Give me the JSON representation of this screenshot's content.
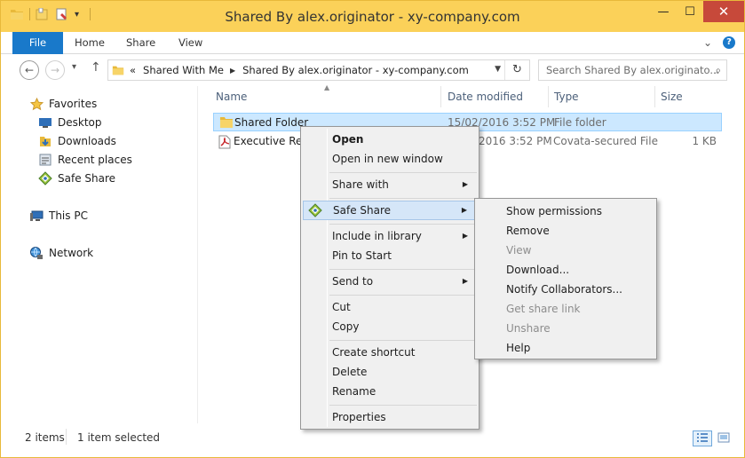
{
  "window": {
    "title": "Shared By alex.originator - xy-company.com",
    "minimize": "—",
    "maximize": "☐",
    "close": "✕"
  },
  "ribbon": {
    "tabs": [
      "File",
      "Home",
      "Share",
      "View"
    ],
    "expand": "⌄",
    "help": "?"
  },
  "nav": {
    "back": "←",
    "forward": "→",
    "recent": "▾",
    "up": "↑",
    "overflow": "«",
    "crumbs": [
      "Shared With Me",
      "Shared By alex.originator - xy-company.com"
    ],
    "search_placeholder": "Search Shared By alex.originato..."
  },
  "sidebar": {
    "favorites": "Favorites",
    "favorite_items": [
      "Desktop",
      "Downloads",
      "Recent places",
      "Safe Share"
    ],
    "this_pc": "This PC",
    "network": "Network"
  },
  "columns": [
    "Name",
    "Date modified",
    "Type",
    "Size"
  ],
  "files": [
    {
      "name": "Shared Folder",
      "date": "15/02/2016 3:52 PM",
      "type": "File folder",
      "size": "",
      "selected": true,
      "icon": "folder-icon"
    },
    {
      "name": "Executive Repo",
      "date": "2016 3:52 PM",
      "type": "Covata-secured File",
      "size": "1 KB",
      "selected": false,
      "icon": "pdf-icon"
    }
  ],
  "status": {
    "items": "2 items",
    "selected": "1 item selected"
  },
  "context_menu": {
    "groups": [
      [
        "Open",
        "Open in new window"
      ],
      [
        "Share with"
      ],
      [
        "Safe Share"
      ],
      [
        "Include in library",
        "Pin to Start"
      ],
      [
        "Send to"
      ],
      [
        "Cut",
        "Copy"
      ],
      [
        "Create shortcut",
        "Delete",
        "Rename"
      ],
      [
        "Properties"
      ]
    ],
    "open": "Open",
    "open_new_window": "Open in new window",
    "share_with": "Share with",
    "safe_share": "Safe Share",
    "include_library": "Include in library",
    "pin_start": "Pin to Start",
    "send_to": "Send to",
    "cut": "Cut",
    "copy": "Copy",
    "create_shortcut": "Create shortcut",
    "delete": "Delete",
    "rename": "Rename",
    "properties": "Properties"
  },
  "submenu": {
    "show_permissions": "Show permissions",
    "remove": "Remove",
    "view": "View",
    "download": "Download...",
    "notify": "Notify Collaborators...",
    "get_share_link": "Get share link",
    "unshare": "Unshare",
    "help": "Help"
  },
  "colors": {
    "titlebar": "#fbd159",
    "file_tab": "#1979ca",
    "close_button": "#c7493a",
    "selection": "#cce8ff",
    "menu_hover": "#d5e6f8"
  }
}
